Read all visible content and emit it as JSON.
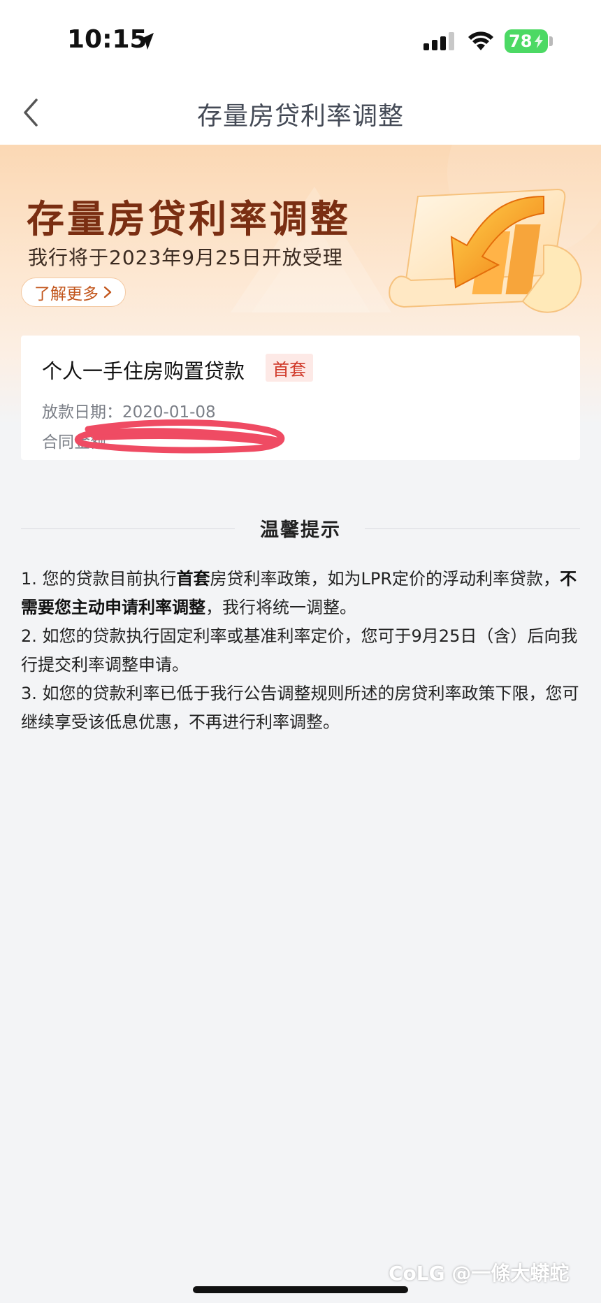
{
  "status_bar": {
    "time": "10:15",
    "battery": "78",
    "icons": [
      "location-arrow-icon",
      "cellular-signal-icon",
      "wifi-icon",
      "battery-charging-icon"
    ]
  },
  "nav": {
    "title": "存量房贷利率调整",
    "back_icon": "chevron-left-icon"
  },
  "banner": {
    "title": "存量房贷利率调整",
    "subtitle": "我行将于2023年9月25日开放受理",
    "learn_more": "了解更多",
    "colors": {
      "title": "#7a2e12",
      "accent": "#f29a1d"
    }
  },
  "loan": {
    "type": "个人一手住房购置贷款",
    "badge": "首套",
    "date_label": "放款日期：",
    "date_value": "2020-01-08",
    "amount_label": "合同金额"
  },
  "tips": {
    "title": "温馨提示",
    "item1": {
      "a": "1. 您的贷款目前执行",
      "b": "首套",
      "c": "房贷利率政策，如为LPR定价的浮动利率贷款，",
      "d": "不需要您主动申请利率调整",
      "e": "，我行将统一调整。"
    },
    "item2": "2. 如您的贷款执行固定利率或基准利率定价，您可于9月25日（含）后向我行提交利率调整申请。",
    "item3": "3. 如您的贷款利率已低于我行公告调整规则所述的房贷利率政策下限，您可继续享受该低息优惠，不再进行利率调整。"
  },
  "watermark": "CoLG @一條大蟒蛇"
}
